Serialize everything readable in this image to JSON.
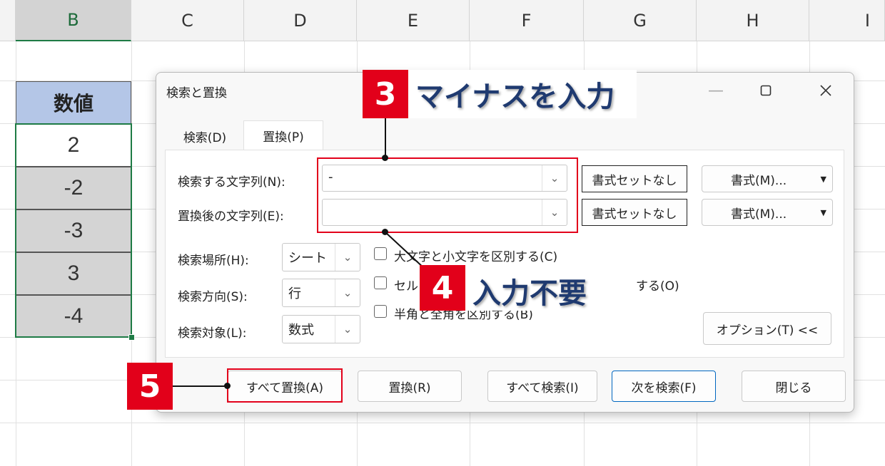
{
  "spreadsheet": {
    "columns": [
      "B",
      "C",
      "D",
      "E",
      "F",
      "G",
      "H",
      "I"
    ],
    "selected_column": "B",
    "header_cell": "数値",
    "values": [
      "2",
      "-2",
      "-3",
      "3",
      "-4"
    ]
  },
  "dialog": {
    "title": "検索と置換",
    "tabs": [
      {
        "label": "検索(D)"
      },
      {
        "label": "置換(P)"
      }
    ],
    "find_label": "検索する文字列(N):",
    "find_value": "-",
    "replace_label": "置換後の文字列(E):",
    "replace_value": "",
    "no_format_label": "書式セットなし",
    "format_label": "書式(M)...",
    "within_label": "検索場所(H):",
    "within_value": "シート",
    "search_label": "検索方向(S):",
    "search_value": "行",
    "lookin_label": "検索対象(L):",
    "lookin_value": "数式",
    "opt_case": "大文字と小文字を区別する(C)",
    "opt_cell_start": "セル",
    "opt_cell_end": "する(O)",
    "opt_width": "半角と全角を区別する(B)",
    "options_button": "オプション(T) <<",
    "buttons": {
      "replace_all": "すべて置換(A)",
      "replace": "置換(R)",
      "find_all": "すべて検索(I)",
      "find_next": "次を検索(F)",
      "close": "閉じる"
    }
  },
  "annotations": {
    "step3_num": "3",
    "step3_text": "マイナスを入力",
    "step4_num": "4",
    "step4_text": "入力不要",
    "step5_num": "5"
  },
  "colors": {
    "accent_red": "#e2001a",
    "caption_navy": "#1f3a70",
    "header_blue": "#b4c6e7",
    "select_green": "#1e7b45"
  }
}
